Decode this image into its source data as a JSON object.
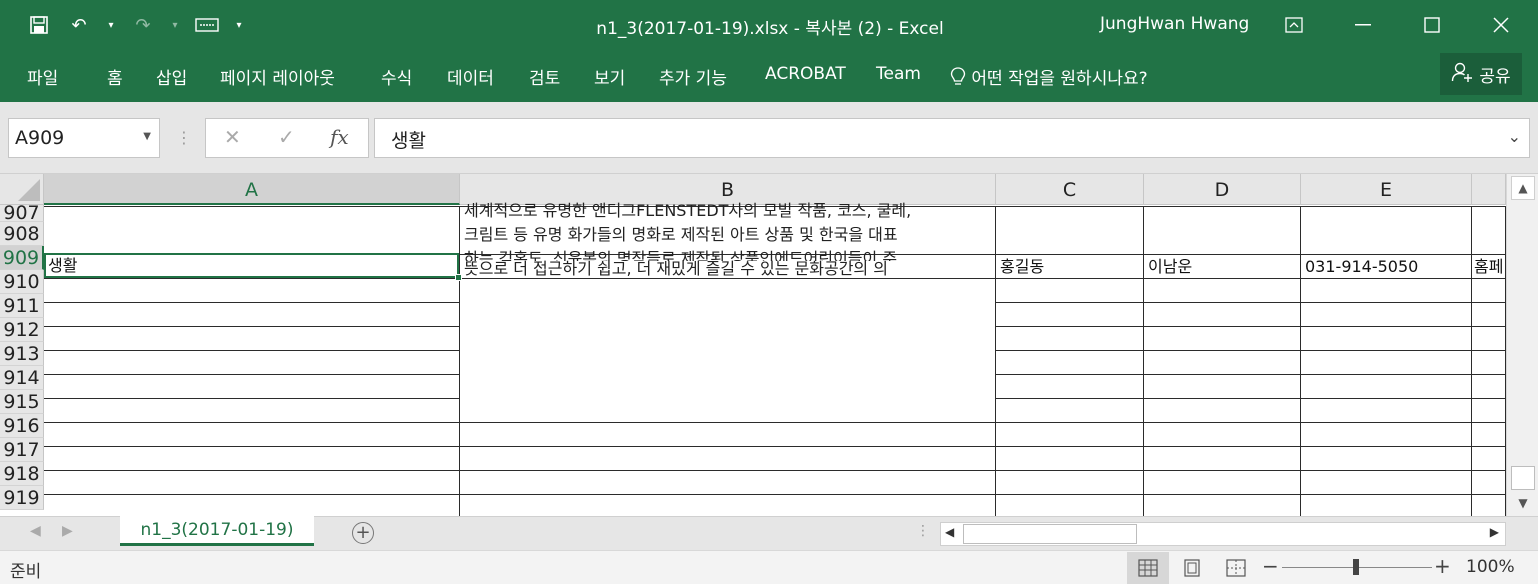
{
  "window": {
    "title": "n1_3(2017-01-19).xlsx - 복사본 (2)  -  Excel",
    "user": "JungHwan Hwang"
  },
  "ribbon": {
    "tabs": [
      "파일",
      "홈",
      "삽입",
      "페이지 레이아웃",
      "수식",
      "데이터",
      "검토",
      "보기",
      "추가 기능",
      "ACROBAT",
      "Team"
    ],
    "tell_me": "어떤 작업을 원하시나요?",
    "share": "공유"
  },
  "formula_bar": {
    "name_box": "A909",
    "content": "생활",
    "fx": "fx"
  },
  "grid": {
    "columns": [
      "A",
      "B",
      "C",
      "D",
      "E"
    ],
    "rows": [
      "907",
      "908",
      "909",
      "910",
      "911",
      "912",
      "913",
      "914",
      "915",
      "916",
      "917",
      "918",
      "919"
    ],
    "row909": {
      "a": "생활",
      "c": "홍길동",
      "d": "이남운",
      "e": "031-914-5050",
      "f": "홈페"
    },
    "b_lines": [
      "세계적으로 유명한 앤디그FLENSTEDT사의 모빌 작품, 코스, 쿨레,",
      "크림트 등 유명 화가들의 명화로 제작된 아트 상품 및 한국을 대표",
      "하는 김홍도, 신윤복의 명작들로 제작된 상품인에드어린이들이 주",
      "뜻으로 더 접근하기 쉽고, 더 재밌게 즐길 수 있는 문화공간의 의"
    ]
  },
  "sheets": {
    "active": "n1_3(2017-01-19)"
  },
  "status": {
    "ready": "준비",
    "zoom": "100%"
  },
  "colors": {
    "accent": "#217346"
  }
}
